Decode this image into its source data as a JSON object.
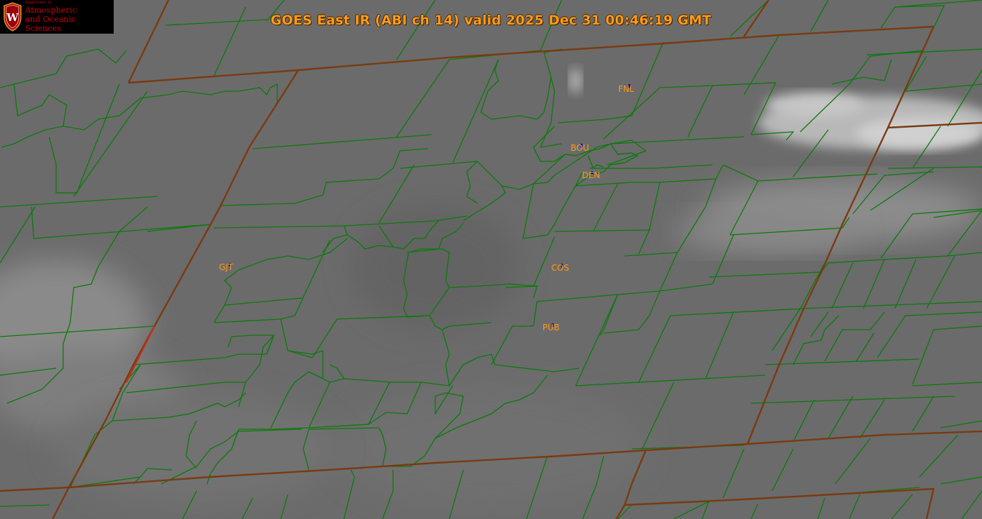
{
  "title": "GOES East IR (ABI ch 14) valid 2025 Dec 31 00:46:19 GMT",
  "logo": {
    "department": "Department of",
    "line1": "Atmospheric",
    "line2": "and Oceanic Sciences",
    "icon": "uw-crest-icon"
  },
  "stations": [
    {
      "id": "FNL",
      "label": "FNL"
    },
    {
      "id": "BOU",
      "label": "BOU"
    },
    {
      "id": "DEN",
      "label": "DEN"
    },
    {
      "id": "GJT",
      "label": "GJT"
    },
    {
      "id": "COS",
      "label": "COS"
    },
    {
      "id": "PUB",
      "label": "PUB"
    }
  ],
  "colors": {
    "background_gray": "#6a6a6a",
    "county_lines": "#0a7a0a",
    "state_lines": "#7a3a10",
    "labels": "#ff9a1a",
    "station_marker": "#1010c0",
    "logo_red": "#c5050c"
  }
}
